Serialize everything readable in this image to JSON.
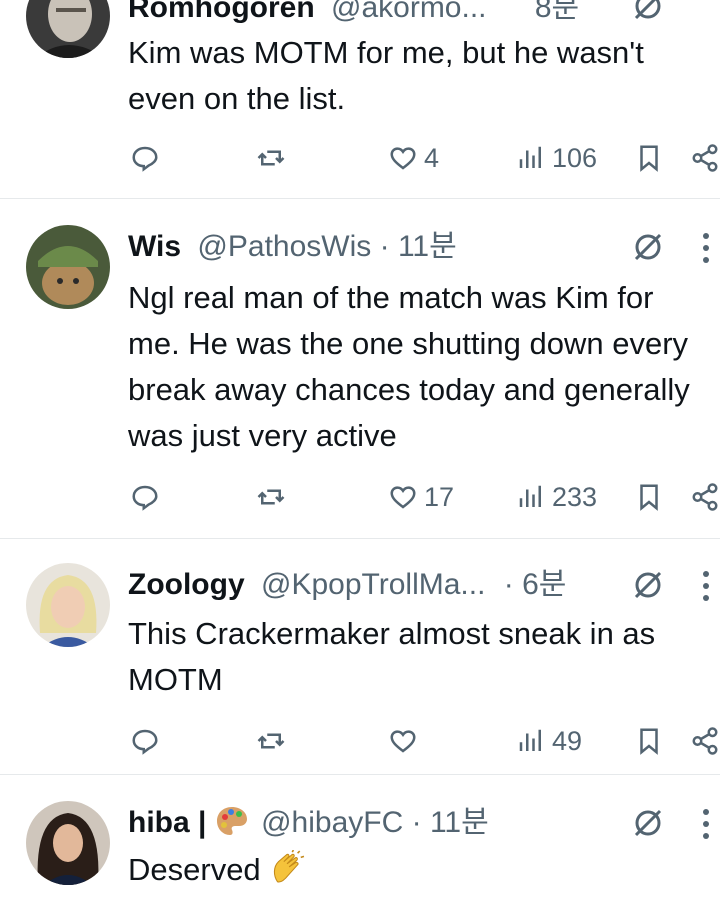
{
  "replies": [
    {
      "name": "Romhogoren",
      "handle": "@akormo...",
      "time": "8분",
      "text": "Kim was MOTM for me, but he wasn't even on the list.",
      "likes": "4",
      "views": "106"
    },
    {
      "name": "Wis",
      "handle": "@PathosWis",
      "separator": "·",
      "time": "11분",
      "text": "Ngl real man of the match was Kim for me. He was the one shutting down every break away chances today and generally was just very active",
      "likes": "17",
      "views": "233"
    },
    {
      "name": "Zoology",
      "handle": "@KpopTrollMa...",
      "separator": "·",
      "time": "6분",
      "text": "This Crackermaker almost sneak in as MOTM",
      "likes": "",
      "views": "49"
    },
    {
      "name": "hiba |",
      "name_emoji": "palette-emoji",
      "handle": "@hibayFC",
      "separator": "·",
      "time": "11분",
      "text": "Deserved",
      "text_emoji": "clapping-hands-emoji"
    }
  ],
  "colors": {
    "text": "#0f1419",
    "secondary": "#536471",
    "divider": "#e6e9eb"
  }
}
